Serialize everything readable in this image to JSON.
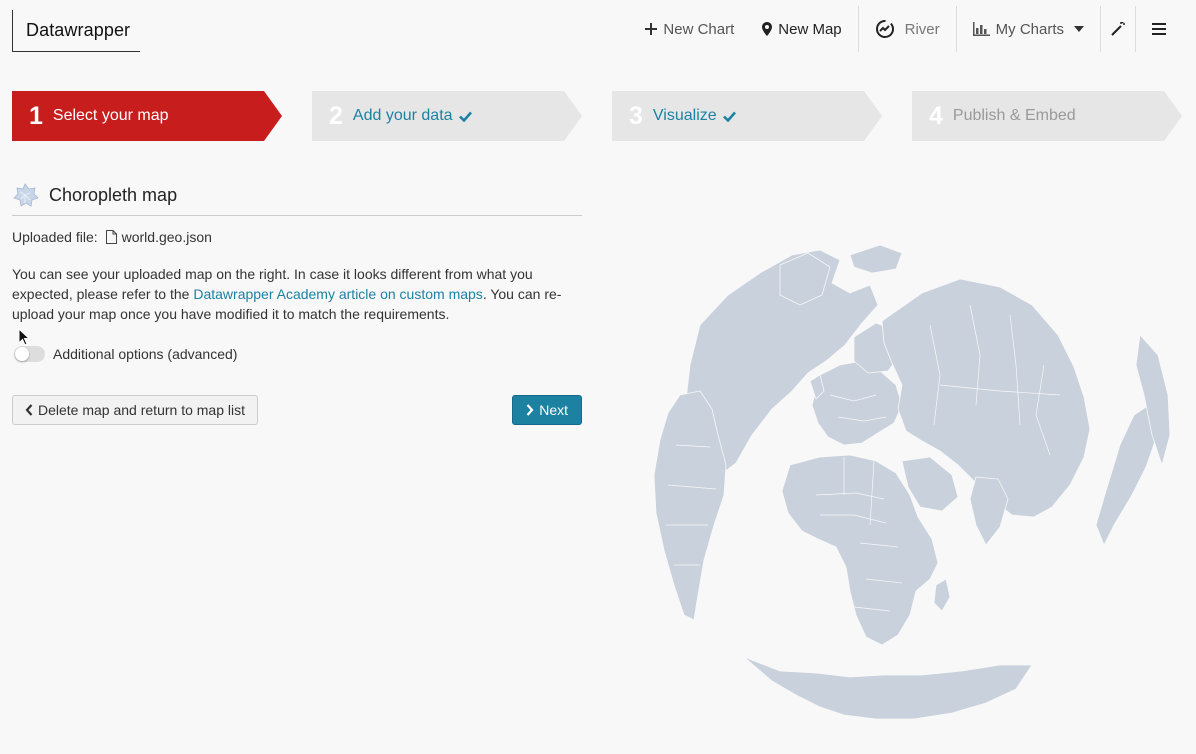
{
  "header": {
    "logo": "Datawrapper",
    "nav": {
      "new_chart": "New Chart",
      "new_map": "New Map",
      "river": "River",
      "my_charts": "My Charts"
    }
  },
  "steps": [
    {
      "num": "1",
      "label": "Select your map",
      "state": "active"
    },
    {
      "num": "2",
      "label": "Add your data",
      "state": "done"
    },
    {
      "num": "3",
      "label": "Visualize",
      "state": "done"
    },
    {
      "num": "4",
      "label": "Publish & Embed",
      "state": "disabled"
    }
  ],
  "panel": {
    "map_type": "Choropleth map",
    "uploaded_label": "Uploaded file:",
    "uploaded_file": "world.geo.json",
    "desc_before": "You can see your uploaded map on the right. In case it looks different from what you expected, please refer to the ",
    "desc_link": "Datawrapper Academy article on custom maps",
    "desc_after": ". You can re-upload your map once you have modified it to match the requirements.",
    "advanced_label": "Additional options (advanced)",
    "advanced_enabled": false,
    "delete_button": "Delete map and return to map list",
    "next_button": "Next"
  },
  "colors": {
    "accent": "#1d81a2",
    "active_step": "#c71e1d",
    "land": "#c8d1dc"
  },
  "icons": [
    "plus-icon",
    "map-marker-icon",
    "river-icon",
    "bar-chart-icon",
    "caret-down-icon",
    "magic-wand-icon",
    "hamburger-icon",
    "check-icon",
    "choropleth-icon",
    "file-icon",
    "chevron-left-icon",
    "chevron-right-icon",
    "cursor-icon"
  ]
}
